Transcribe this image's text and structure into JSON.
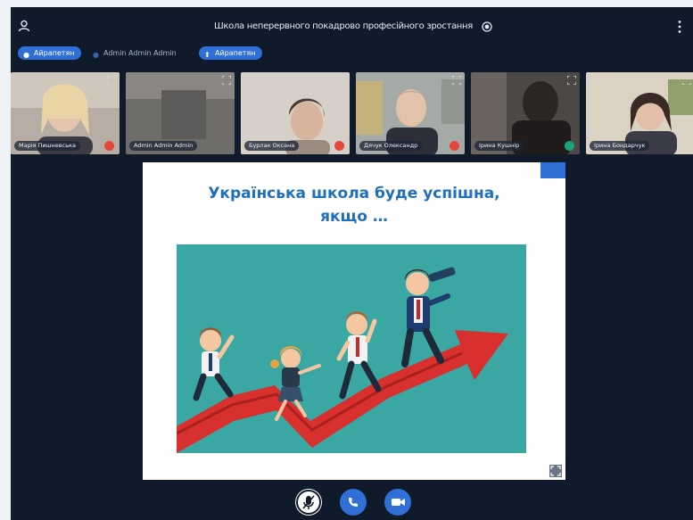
{
  "meeting": {
    "title": "Школа неперервного покадрово професійного зростання"
  },
  "chips": [
    {
      "label": "Айрапетян",
      "icon": "user-icon",
      "style": "blue"
    },
    {
      "label": "Admin Admin Admin",
      "icon": "user-icon",
      "style": "dark"
    },
    {
      "label": "Айрапетян",
      "icon": "upload-icon",
      "style": "blue"
    }
  ],
  "participants": [
    {
      "name": "Марія Пишневська",
      "mic": "muted",
      "bg": "#b5aaa0"
    },
    {
      "name": "Admin Admin Admin",
      "mic": "none",
      "bg": "#7c7a77"
    },
    {
      "name": "Бурлак Оксана",
      "mic": "muted",
      "bg": "#ccc6bd"
    },
    {
      "name": "Дячук Олександр",
      "mic": "muted",
      "bg": "#9aa4a0"
    },
    {
      "name": "Ірина Кушнір",
      "mic": "active",
      "bg": "#5b5755"
    },
    {
      "name": "Ірина Бондарчук",
      "mic": "none",
      "bg": "#d9cfc2"
    }
  ],
  "slide": {
    "title_line1": "Українська школа буде успішна,",
    "title_line2": "якщо …",
    "bg_color": "#3aa7a3",
    "arrow_color": "#d8302f",
    "accent": "#1f6fbf"
  },
  "controls": [
    {
      "name": "mute-button",
      "icon": "mic-icon"
    },
    {
      "name": "leave-audio-button",
      "icon": "phone-icon"
    },
    {
      "name": "share-webcam-button",
      "icon": "video-icon"
    }
  ]
}
